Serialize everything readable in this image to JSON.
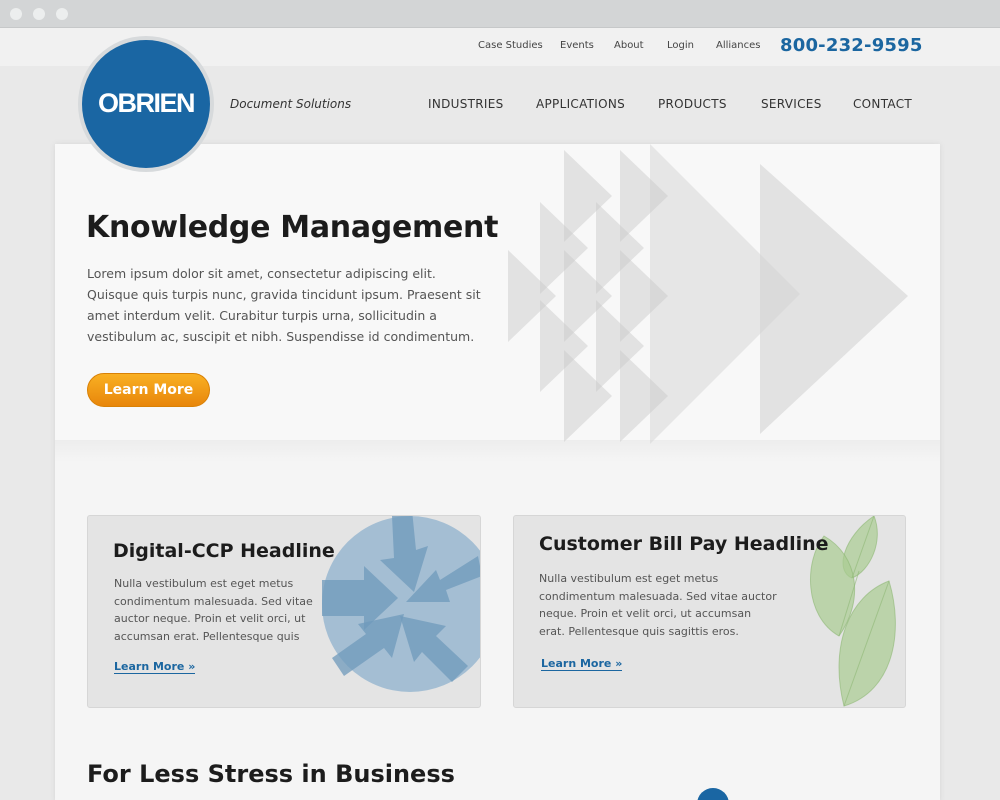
{
  "utility_nav": {
    "links": [
      "Case Studies",
      "Events",
      "About",
      "Login",
      "Alliances"
    ],
    "phone": "800-232-9595"
  },
  "brand": {
    "logo_text": "OBRIEN",
    "tagline": "Document Solutions"
  },
  "main_nav": [
    "INDUSTRIES",
    "APPLICATIONS",
    "PRODUCTS",
    "SERVICES",
    "CONTACT"
  ],
  "hero": {
    "title": "Knowledge Management",
    "body": "Lorem ipsum dolor sit amet, consectetur adipiscing elit. Quisque quis turpis nunc, gravida tincidunt ipsum. Praesent sit amet interdum velit. Curabitur turpis urna, sollicitudin a vestibulum ac, suscipit et nibh. Suspendisse id condimentum.",
    "button_label": "Learn More"
  },
  "cards": [
    {
      "title": "Digital-CCP Headline",
      "body": "Nulla vestibulum est eget metus condimentum malesuada. Sed vitae auctor neque. Proin et velit orci, ut accumsan erat. Pellentesque quis",
      "link": "Learn More »"
    },
    {
      "title": "Customer Bill Pay Headline",
      "body": "Nulla vestibulum est eget metus condimentum malesuada. Sed vitae auctor neque. Proin et velit orci, ut accumsan erat. Pellentesque quis sagittis eros.",
      "link": "Learn More »"
    }
  ],
  "section_title": "For Less Stress in Business",
  "colors": {
    "brand_blue": "#1a66a3",
    "button_orange": "#f0a018",
    "leaf_green": "#9cc584",
    "arrow_blue": "#7ea7c6"
  }
}
